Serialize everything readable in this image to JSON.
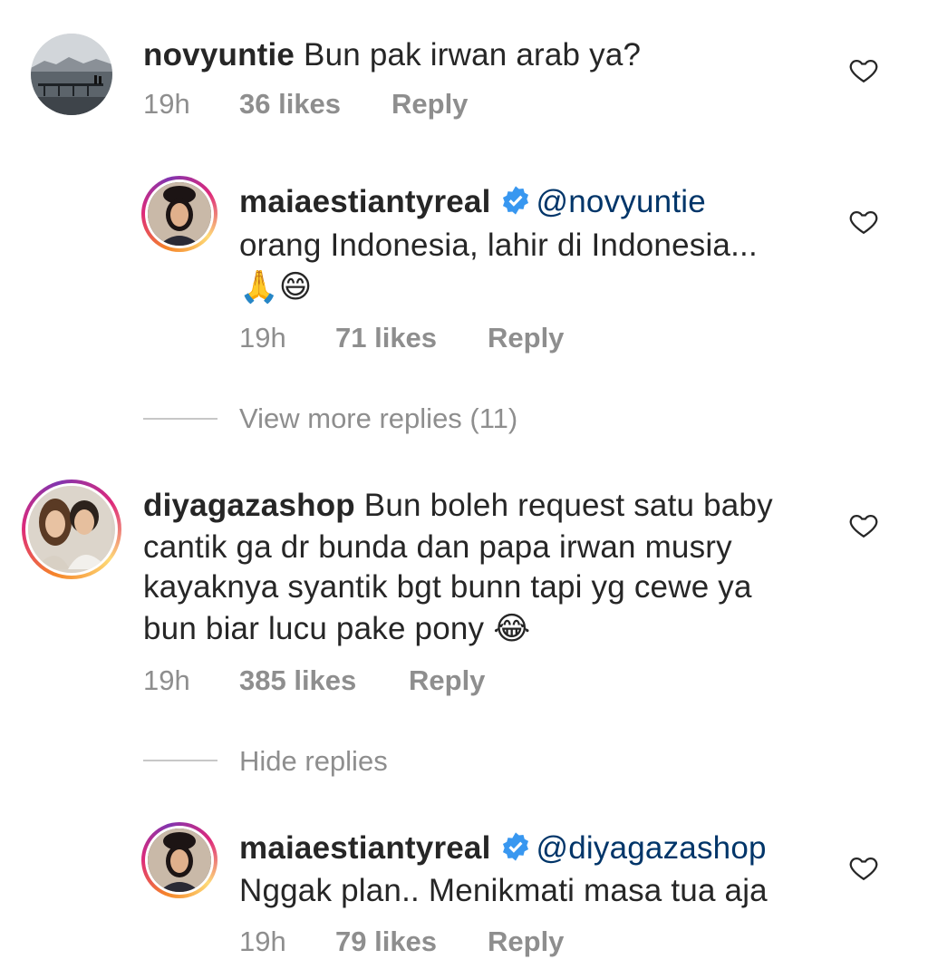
{
  "comments": [
    {
      "username": "novyuntie",
      "text": "Bun pak irwan arab ya?",
      "time": "19h",
      "likes": "36 likes",
      "reply": "Reply",
      "avatar": "landscape-pier-photo"
    },
    {
      "username": "maiaestiantyreal",
      "verified": true,
      "mention": "@novyuntie",
      "line2": "orang Indonesia, lahir di Indonesia...",
      "emojis": "🙏😄",
      "time": "19h",
      "likes": "71 likes",
      "reply": "Reply"
    },
    {
      "username": "diyagazashop",
      "line1": "Bun boleh request satu baby",
      "line2": "cantik ga dr bunda dan papa irwan musry",
      "line3": "kayaknya syantik bgt bunn tapi yg cewe ya",
      "line4": "bun biar lucu pake pony",
      "emoji": "😂",
      "time": "19h",
      "likes": "385 likes",
      "reply": "Reply"
    },
    {
      "username": "maiaestiantyreal",
      "verified": true,
      "mention": "@diyagazashop",
      "line2": "Nggak plan.. Menikmati masa tua aja",
      "time": "19h",
      "likes": "79 likes",
      "reply": "Reply"
    }
  ],
  "threads": {
    "view_more": "View more replies (11)",
    "hide": "Hide replies"
  },
  "colors": {
    "username": "#262626",
    "meta": "#8e8e8e",
    "mention": "#003569",
    "verified": "#3897f0"
  }
}
